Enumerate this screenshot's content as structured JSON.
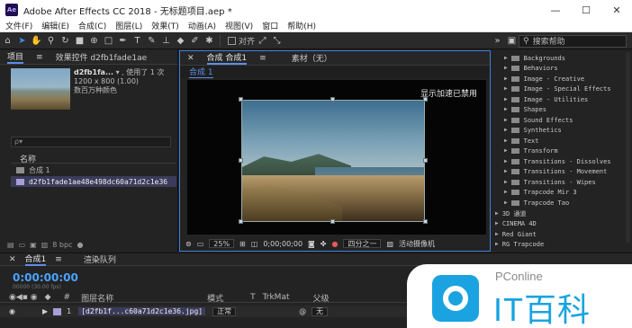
{
  "window": {
    "title": "Adobe After Effects CC 2018 - 无标题项目.aep *",
    "logo_text": "Ae",
    "minimize": "—",
    "maximize": "☐",
    "close": "✕"
  },
  "menu": [
    "文件(F)",
    "编辑(E)",
    "合成(C)",
    "图层(L)",
    "效果(T)",
    "动画(A)",
    "视图(V)",
    "窗口",
    "帮助(H)"
  ],
  "toolbar": {
    "snap_label": "对齐",
    "search_placeholder": "搜索帮助"
  },
  "project_panel": {
    "tab_project": "项目",
    "tab_effects_controls": "效果控件 d2fb1fade1ae",
    "file_name": "d2fb1fa...",
    "used_count": "▾ , 使用了 1 次",
    "file_dims": "1200 x 800 (1.00)",
    "file_colors": "数百万种颜色",
    "search_placeholder": "ρ▾",
    "col_name": "名称",
    "items": [
      {
        "name": "合成 1",
        "selected": false
      },
      {
        "name": "d2fb1fade1ae48e498dc60a71d2c1e36",
        "selected": true
      }
    ],
    "bpc": "8 bpc"
  },
  "comp_panel": {
    "tab_comp": "合成 合成1",
    "tab_footage": "素材（无）",
    "sub_tab": "合成 1",
    "gpu_notice": "显示加速已禁用",
    "zoom": "25%",
    "timecode": "0;00;00;00",
    "resolution": "四分之一",
    "camera": "活动摄像机"
  },
  "effects_panel": {
    "items": [
      "Backgrounds",
      "Behaviors",
      "Image - Creative",
      "Image - Special Effects",
      "Image - Utilities",
      "Shapes",
      "Sound Effects",
      "Synthetics",
      "Text",
      "Transform",
      "Transitions - Dissolves",
      "Transitions - Movement",
      "Transitions - Wipes",
      "Trapcode Mir 3",
      "Trapcode Tao"
    ],
    "groups": [
      "3D 通道",
      "CINEMA 4D",
      "Red Giant",
      "RG Trapcode"
    ]
  },
  "timeline": {
    "tab_comp": "合成1",
    "tab_render": "渲染队列",
    "timecode": "0:00:00:00",
    "timecode_sub": "00000 (30.00 fps)",
    "col_layer_name": "图层名称",
    "col_mode": "模式",
    "col_t": "T",
    "col_trkmat": "TrkMat",
    "col_parent": "父级",
    "layer_index": "1",
    "layer_name": "[d2fb1f...c60a71d2c1e36.jpg]",
    "layer_mode": "正常",
    "layer_parent": "无"
  },
  "watermark": {
    "brand": "PConline",
    "text": "IT百科"
  }
}
